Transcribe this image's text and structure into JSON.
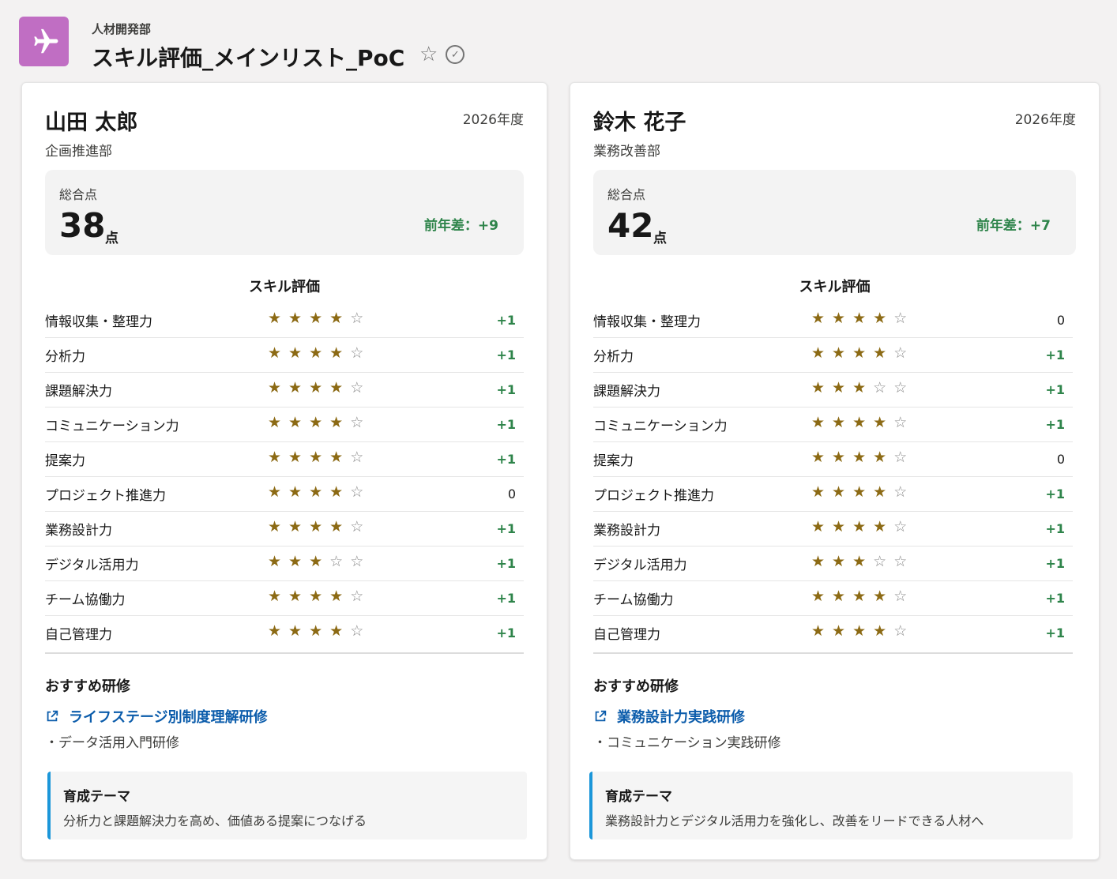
{
  "header": {
    "object_label": "人材開発部",
    "title": "スキル評価_メインリスト_PoC",
    "favorite_icon": "☆",
    "check_icon": "✓"
  },
  "employees": [
    {
      "name": "山田 太郎",
      "department": "企画推進部",
      "year": "2026年度",
      "score_label": "総合点",
      "score": "38",
      "score_unit": "点",
      "score_diff": "前年差：+9",
      "skills_title": "スキル評価",
      "skills": [
        {
          "name": "情報収集・整理力",
          "stars": 4,
          "diff": "+1"
        },
        {
          "name": "分析力",
          "stars": 4,
          "diff": "+1"
        },
        {
          "name": "課題解決力",
          "stars": 4,
          "diff": "+1"
        },
        {
          "name": "コミュニケーション力",
          "stars": 4,
          "diff": "+1"
        },
        {
          "name": "提案力",
          "stars": 4,
          "diff": "+1"
        },
        {
          "name": "プロジェクト推進力",
          "stars": 4,
          "diff": "0"
        },
        {
          "name": "業務設計力",
          "stars": 4,
          "diff": "+1"
        },
        {
          "name": "デジタル活用力",
          "stars": 3,
          "diff": "+1"
        },
        {
          "name": "チーム協働力",
          "stars": 4,
          "diff": "+1"
        },
        {
          "name": "自己管理力",
          "stars": 4,
          "diff": "+1"
        }
      ],
      "reco_title": "おすすめ研修",
      "reco_link": "ライフステージ別制度理解研修",
      "reco_item": "・データ活用入門研修",
      "theme_label": "育成テーマ",
      "theme_text": "分析力と課題解決力を高め、価値ある提案につなげる"
    },
    {
      "name": "鈴木 花子",
      "department": "業務改善部",
      "year": "2026年度",
      "score_label": "総合点",
      "score": "42",
      "score_unit": "点",
      "score_diff": "前年差：+7",
      "skills_title": "スキル評価",
      "skills": [
        {
          "name": "情報収集・整理力",
          "stars": 4,
          "diff": "0"
        },
        {
          "name": "分析力",
          "stars": 4,
          "diff": "+1"
        },
        {
          "name": "課題解決力",
          "stars": 3,
          "diff": "+1"
        },
        {
          "name": "コミュニケーション力",
          "stars": 4,
          "diff": "+1"
        },
        {
          "name": "提案力",
          "stars": 4,
          "diff": "0"
        },
        {
          "name": "プロジェクト推進力",
          "stars": 4,
          "diff": "+1"
        },
        {
          "name": "業務設計力",
          "stars": 4,
          "diff": "+1"
        },
        {
          "name": "デジタル活用力",
          "stars": 3,
          "diff": "+1"
        },
        {
          "name": "チーム協働力",
          "stars": 4,
          "diff": "+1"
        },
        {
          "name": "自己管理力",
          "stars": 4,
          "diff": "+1"
        }
      ],
      "reco_title": "おすすめ研修",
      "reco_link": "業務設計力実践研修",
      "reco_item": "・コミュニケーション実践研修",
      "theme_label": "育成テーマ",
      "theme_text": "業務設計力とデジタル活用力を強化し、改善をリードできる人材へ"
    }
  ],
  "colors": {
    "app_icon": "#c06ec3",
    "star_filled": "#8c6a14",
    "diff_positive": "#2e844a",
    "link": "#0b5cab",
    "theme_accent": "#1b96d9"
  }
}
